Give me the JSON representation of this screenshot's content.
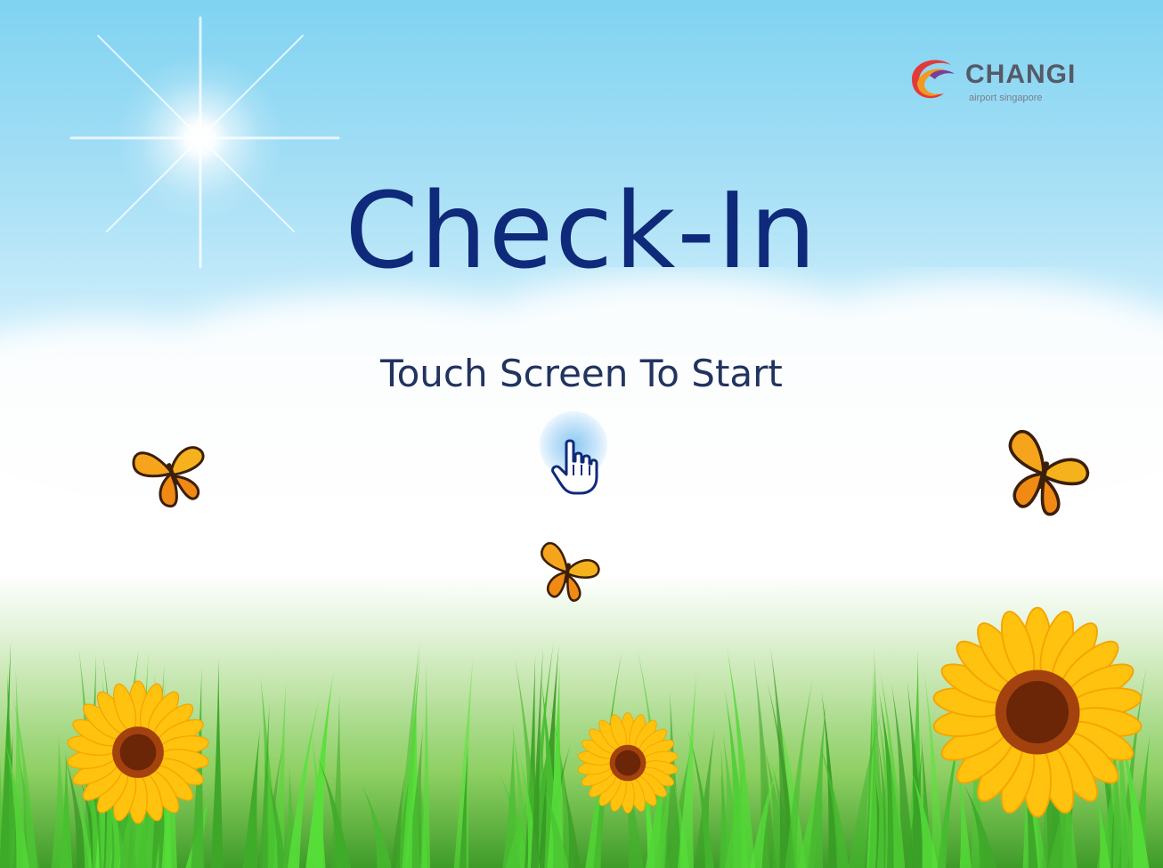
{
  "screen": {
    "title": "Check-In",
    "prompt": "Touch Screen To Start"
  },
  "logo": {
    "name": "CHANGI",
    "tagline": "airport singapore"
  },
  "icons": {
    "touch": "hand-pointer-icon",
    "sun": "sun-icon",
    "butterfly": "butterfly-icon",
    "sunflower": "sunflower-icon"
  },
  "colors": {
    "title": "#0f2a7a",
    "prompt": "#22335f",
    "sky": "#7fd3f1",
    "grass": "#4aa82f",
    "petal": "#ffc20e"
  }
}
